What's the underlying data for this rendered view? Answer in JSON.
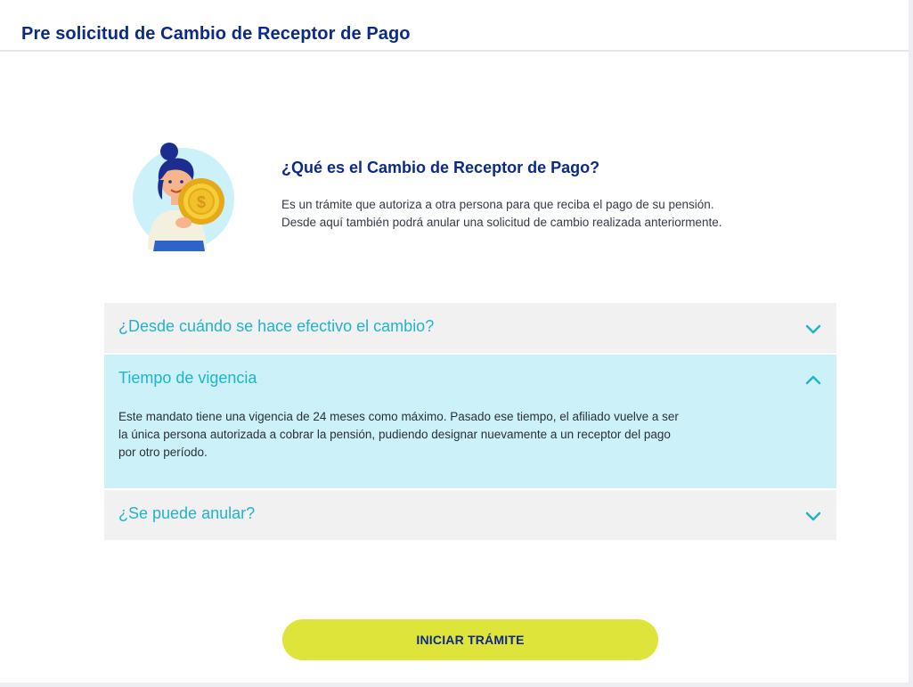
{
  "header": {
    "title": "Pre solicitud de Cambio de Receptor de Pago"
  },
  "intro": {
    "illustration_icon": "person-with-coin-illustration",
    "title": "¿Qué es el Cambio de Receptor de Pago?",
    "text_lines": [
      "Es un trámite que autoriza a otra persona para que reciba el pago de su pensión.",
      "Desde aquí también podrá anular una solicitud de cambio realizada anteriormente."
    ]
  },
  "faq": [
    {
      "question": "¿Desde cuándo se hace efectivo el cambio?",
      "expanded": false,
      "icon": "chevron-down-icon"
    },
    {
      "question": "Tiempo de vigencia",
      "expanded": true,
      "icon": "chevron-up-icon",
      "answer_lines": [
        "Este mandato tiene una vigencia de 24 meses como máximo. Pasado ese tiempo, el afiliado vuelve a ser",
        "la única persona autorizada a cobrar la pensión, pudiendo designar nuevamente a un receptor del pago",
        "por otro período."
      ]
    },
    {
      "question": "¿Se puede anular?",
      "expanded": false,
      "icon": "chevron-down-icon"
    }
  ],
  "actions": {
    "start_label": "INICIAR TRÁMITE"
  },
  "colors": {
    "primary": "#0b2a87",
    "accent": "#1fb3cd",
    "expanded_bg": "#cdf1f8",
    "collapsed_bg": "#f1f1f2",
    "button_bg": "#dfe43a"
  }
}
